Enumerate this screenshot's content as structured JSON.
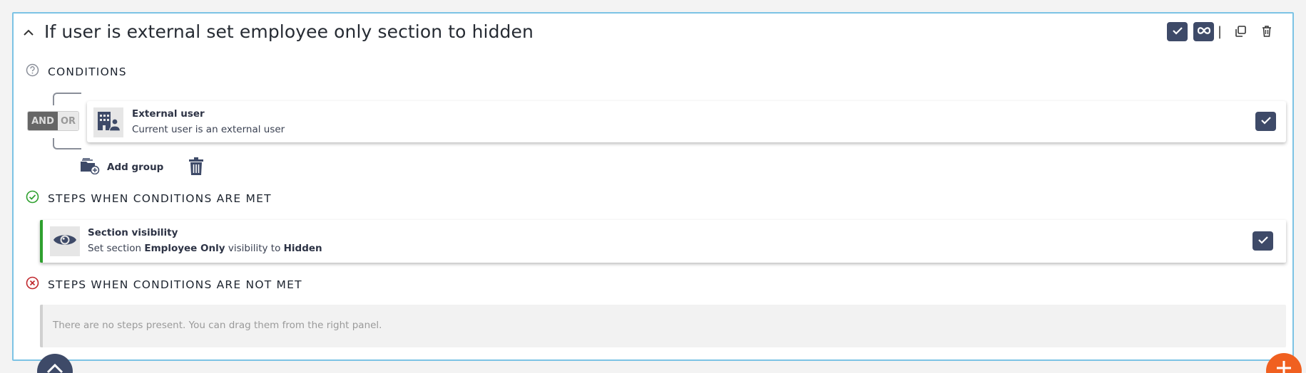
{
  "rule": {
    "title": "If user is external set employee only section to hidden"
  },
  "sections": {
    "conditions_label": "CONDITIONS",
    "met_label": "STEPS WHEN CONDITIONS ARE MET",
    "not_met_label": "STEPS WHEN CONDITIONS ARE NOT MET"
  },
  "logic": {
    "and_label": "AND",
    "or_label": "OR",
    "selected": "AND"
  },
  "condition": {
    "title": "External user",
    "subtitle": "Current user is an external user",
    "icon": "building-user-icon"
  },
  "add_group": {
    "label": "Add group"
  },
  "step": {
    "title": "Section visibility",
    "sub_prefix": "Set section ",
    "section_name": "Employee Only",
    "sub_middle": " visibility to ",
    "visibility": "Hidden",
    "icon": "eye-icon"
  },
  "empty_steps": {
    "message": "There are no steps present. You can drag them from the right panel."
  },
  "header": {
    "separator": "|"
  },
  "colors": {
    "accent_navy": "#3e4a68",
    "met_green": "#2ea02e",
    "not_met_red": "#c0282d",
    "fab_orange": "#f06020",
    "card_border": "#7cc3e5"
  }
}
